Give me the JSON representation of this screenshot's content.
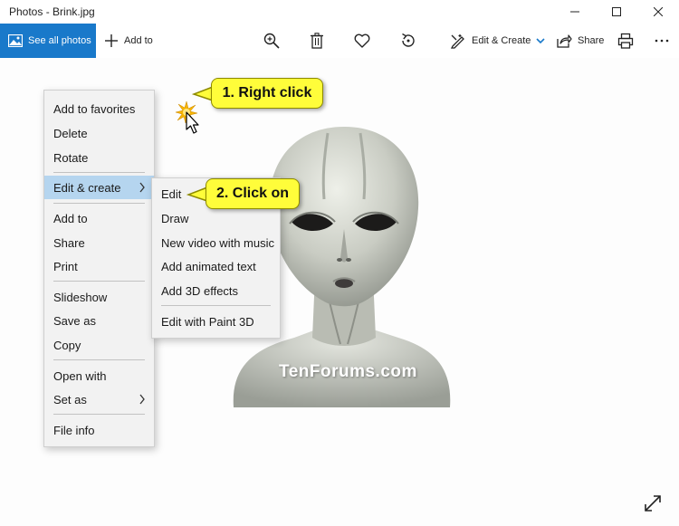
{
  "titlebar": {
    "title": "Photos - Brink.jpg"
  },
  "toolbar": {
    "see_all": "See all photos",
    "add_to": "Add to",
    "edit_create": "Edit & Create",
    "share": "Share"
  },
  "context_menu": {
    "items": [
      {
        "label": "Add to favorites"
      },
      {
        "label": "Delete"
      },
      {
        "label": "Rotate"
      },
      {
        "label": "Edit & create",
        "has_submenu": true,
        "highlighted": true
      },
      {
        "label": "Add to"
      },
      {
        "label": "Share"
      },
      {
        "label": "Print"
      },
      {
        "label": "Slideshow"
      },
      {
        "label": "Save as"
      },
      {
        "label": "Copy"
      },
      {
        "label": "Open with"
      },
      {
        "label": "Set as",
        "has_submenu": true
      },
      {
        "label": "File info"
      }
    ]
  },
  "submenu": {
    "items": [
      {
        "label": "Edit"
      },
      {
        "label": "Draw"
      },
      {
        "label": "New video with music"
      },
      {
        "label": "Add animated text"
      },
      {
        "label": "Add 3D effects"
      },
      {
        "label": "Edit with Paint 3D"
      }
    ]
  },
  "callouts": {
    "step1": "1. Right click",
    "step2": "2. Click on"
  },
  "watermark": "TenForums.com",
  "colors": {
    "accent": "#1979ca",
    "menu_bg": "#f2f2f2",
    "menu_highlight": "#b5d5ef",
    "callout_fill": "#fffd3a"
  }
}
